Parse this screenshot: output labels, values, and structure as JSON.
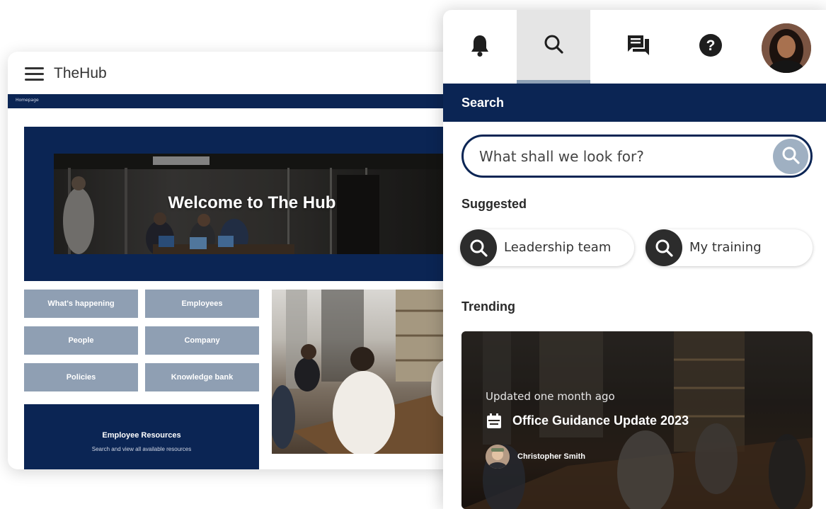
{
  "hub": {
    "title": "TheHub",
    "breadcrumb": "Homepage",
    "banner_title": "Welcome to The Hub",
    "tiles": [
      "What's happening",
      "Employees",
      "People",
      "Company",
      "Policies",
      "Knowledge bank"
    ],
    "resources": {
      "title": "Employee Resources",
      "subtitle": "Search and view all available resources"
    }
  },
  "panel": {
    "toolbar": [
      {
        "icon": "bell-icon"
      },
      {
        "icon": "search-icon",
        "active": true
      },
      {
        "icon": "chat-icon"
      },
      {
        "icon": "help-icon"
      },
      {
        "icon": "user-avatar"
      }
    ],
    "search": {
      "title": "Search",
      "placeholder": "What shall we look for?"
    },
    "suggested": {
      "label": "Suggested",
      "items": [
        "Leadership team",
        "My training"
      ]
    },
    "trending": {
      "label": "Trending",
      "card": {
        "meta": "Updated one month ago",
        "title": "Office Guidance Update 2023",
        "author": "Christopher Smith"
      }
    }
  },
  "colors": {
    "navy": "#0b2554",
    "tile_grey": "#8f9fb3",
    "search_button": "#9fb0c2",
    "active_tab_bg": "#e5e5e5"
  }
}
